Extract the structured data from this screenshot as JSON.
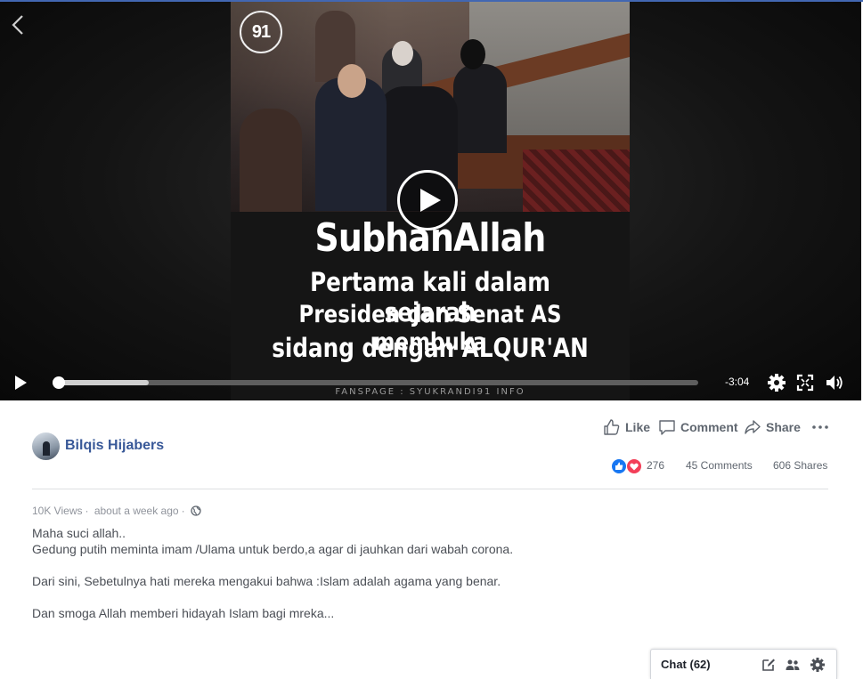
{
  "video": {
    "logo_text": "91",
    "caption_title": "SubhanAllah",
    "caption_line1": "Pertama kali dalam sejarah",
    "caption_line2": "Presiden dan Senat AS membuka",
    "caption_line3": "sidang dengan ALQUR'AN",
    "watermark": "FANSPAGE : SYUKRANDI91 INFO",
    "time_remaining": "-3:04",
    "buffered_fraction": 0.14,
    "played_fraction": 0.0
  },
  "poster": {
    "name": "Bilqis Hijabers"
  },
  "actions": {
    "like": "Like",
    "comment": "Comment",
    "share": "Share"
  },
  "stats": {
    "reactions": "276",
    "comments": "45 Comments",
    "shares": "606 Shares"
  },
  "meta": {
    "views": "10K Views",
    "time": "about a week ago",
    "separator": "·"
  },
  "description": {
    "line1": "Maha suci allah..",
    "line2": "Gedung putih meminta imam /Ulama untuk berdo,a agar di jauhkan dari wabah corona.",
    "line3": "Dari sini, Sebetulnya hati mereka mengakui bahwa :Islam adalah agama yang benar.",
    "line4": "Dan smoga Allah memberi hidayah Islam bagi mreka..."
  },
  "chat": {
    "label": "Chat (62)"
  },
  "colors": {
    "link": "#385898",
    "like": "#1877f2",
    "love": "#f33e58",
    "top_bar": "#4267b2"
  }
}
